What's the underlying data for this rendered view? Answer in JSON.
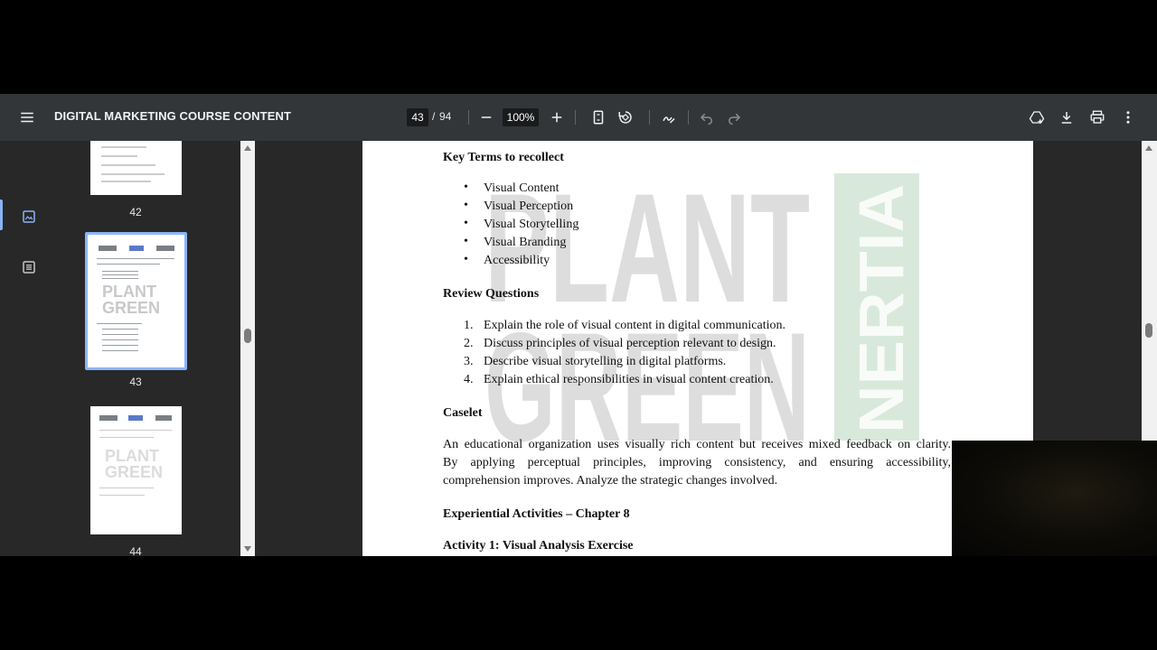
{
  "toolbar": {
    "title": "DIGITAL MARKETING COURSE CONTENT",
    "current_page": "43",
    "page_separator": "/",
    "total_pages": "94",
    "zoom": "100%"
  },
  "icons": {
    "menu": "hamburger-menu-icon",
    "zoom_out": "minus-icon",
    "zoom_in": "plus-icon",
    "fit": "fit-page-icon",
    "rotate": "rotate-icon",
    "annotate": "pen-icon",
    "undo": "undo-icon",
    "redo": "redo-icon",
    "drive": "save-to-drive-icon",
    "download": "download-icon",
    "print": "print-icon",
    "more": "more-vert-icon"
  },
  "thumbnails": [
    {
      "label": "42"
    },
    {
      "label": "43"
    },
    {
      "label": "44"
    }
  ],
  "document": {
    "key_terms_heading": "Key Terms to recollect",
    "key_terms": [
      "Visual Content",
      "Visual Perception",
      "Visual Storytelling",
      "Visual Branding",
      "Accessibility"
    ],
    "review_heading": "Review Questions",
    "review_questions": [
      {
        "num": "1.",
        "text": "Explain the role of visual content in digital communication."
      },
      {
        "num": "2.",
        "text": "Discuss principles of visual perception relevant to design."
      },
      {
        "num": "3.",
        "text": "Describe visual storytelling in digital platforms."
      },
      {
        "num": "4.",
        "text": "Explain ethical responsibilities in visual content creation."
      }
    ],
    "caselet_heading": "Caselet",
    "caselet_lines": [
      "An educational organization uses visually rich content but receives mixed feedback on clarity.",
      "By applying perceptual principles, improving consistency, and ensuring accessibility,",
      "comprehension improves. Analyze the strategic changes involved."
    ],
    "experiential_heading": "Experiential Activities – Chapter 8",
    "activity_heading": "Activity 1: Visual Analysis Exercise"
  },
  "watermark": {
    "left_lines": [
      "PLANT",
      "GREEN"
    ],
    "right_word": "NERTIA"
  },
  "colors": {
    "toolbar_bg": "#323639",
    "viewer_bg": "#282828",
    "selected_thumb_border": "#8ab4f8",
    "watermark_green": "#4f9a5a"
  }
}
